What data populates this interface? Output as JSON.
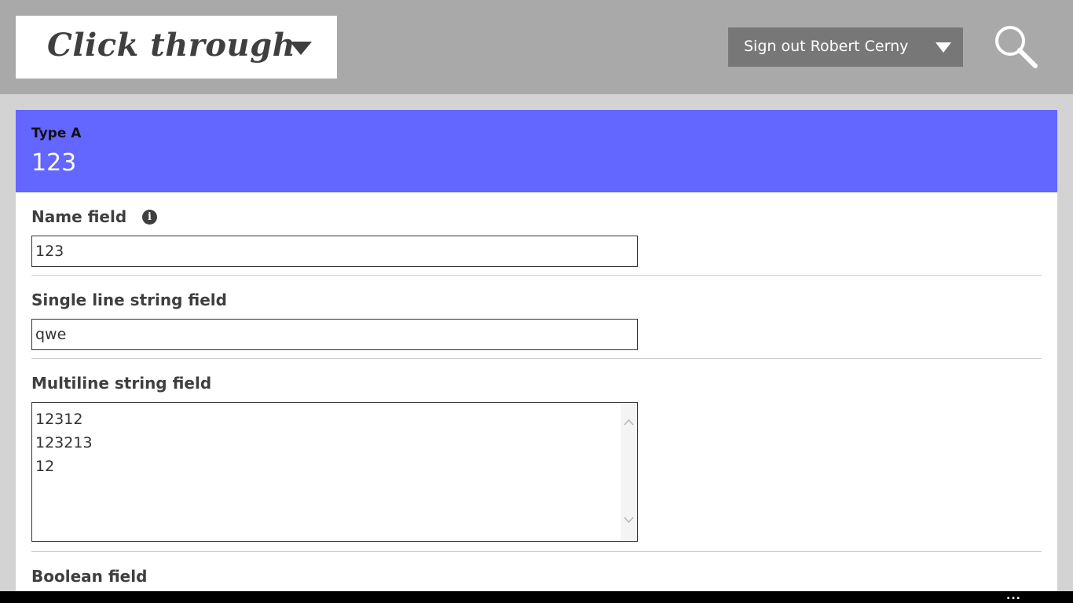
{
  "header": {
    "app_title": "Click through",
    "signout_label": "Sign out Robert Cerny",
    "search_icon": "search-icon"
  },
  "record": {
    "type_label": "Type A",
    "name": "123"
  },
  "fields": {
    "name_field": {
      "label": "Name field",
      "value": "123",
      "info_icon": "info-icon"
    },
    "single_line": {
      "label": "Single line string field",
      "value": "qwe"
    },
    "multiline": {
      "label": "Multiline string field",
      "lines": [
        "12312",
        "123213",
        "12"
      ]
    },
    "boolean": {
      "label": "Boolean field"
    }
  },
  "bottom_bar": {
    "more_label": "..."
  },
  "colors": {
    "header_bar": "#a9a9a9",
    "record_header": "#6366ff",
    "page_background": "#d3d3d3"
  }
}
